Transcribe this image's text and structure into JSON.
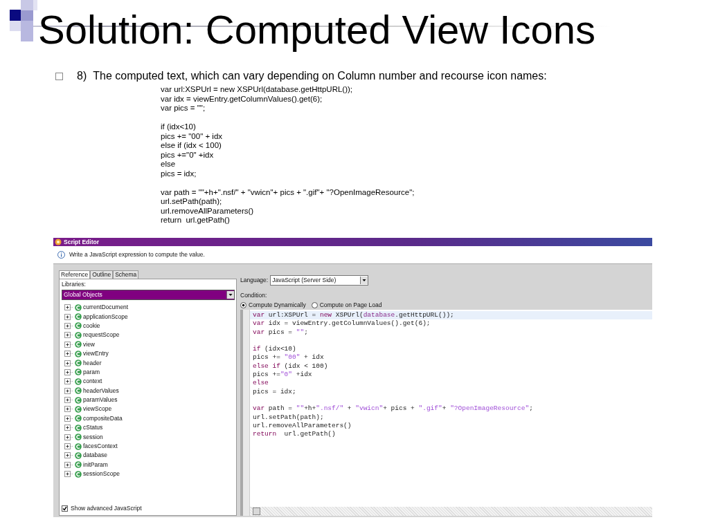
{
  "slide": {
    "title": "Solution: Computed View Icons",
    "bullet": {
      "number": "8)",
      "text": "The computed text, which can vary depending on Column number and recourse icon names:"
    },
    "code_blocks": [
      [
        "var url:XSPUrl = new XSPUrl(database.getHttpURL());",
        "var idx = viewEntry.getColumnValues().get(6);",
        "var pics = \"\";"
      ],
      [
        "if (idx<10)",
        "pics += \"00\" + idx",
        "else if (idx < 100)",
        "pics +=\"0\" +idx",
        "else",
        "pics = idx;"
      ],
      [
        "var path = \"\"+h+\".nsf/\" + \"vwicn\"+ pics + \".gif\"+ \"?OpenImageResource\";",
        "url.setPath(path);",
        "url.removeAllParameters()",
        "return  url.getPath()"
      ]
    ]
  },
  "window": {
    "title": "Script Editor",
    "info": "Write a JavaScript expression to compute the value.",
    "tabs": [
      {
        "label": "Reference",
        "selected": true
      },
      {
        "label": "Outline",
        "selected": false
      },
      {
        "label": "Schema",
        "selected": false
      }
    ],
    "libraries_label": "Libraries:",
    "libraries_value": "Global Objects",
    "tree": [
      {
        "label": "currentDocument",
        "expanded": false
      },
      {
        "label": "applicationScope",
        "expanded": false
      },
      {
        "label": "cookie",
        "expanded": false
      },
      {
        "label": "requestScope",
        "expanded": false
      },
      {
        "label": "view",
        "expanded": false
      },
      {
        "label": "viewEntry",
        "expanded": false
      },
      {
        "label": "header",
        "expanded": false
      },
      {
        "label": "param",
        "expanded": false
      },
      {
        "label": "context",
        "expanded": false
      },
      {
        "label": "headerValues",
        "expanded": false
      },
      {
        "label": "paramValues",
        "expanded": false
      },
      {
        "label": "viewScope",
        "expanded": false
      },
      {
        "label": "compositeData",
        "expanded": false
      },
      {
        "label": "cStatus",
        "expanded": false
      },
      {
        "label": "session",
        "expanded": false
      },
      {
        "label": "facesContext",
        "expanded": false
      },
      {
        "label": "database",
        "expanded": false
      },
      {
        "label": "initParam",
        "expanded": false
      },
      {
        "label": "sessionScope",
        "expanded": false
      }
    ],
    "show_advanced": {
      "label": "Show advanced JavaScript",
      "checked": true
    },
    "language_label": "Language:",
    "language_value": "JavaScript (Server Side)",
    "condition_label": "Condition:",
    "radios": [
      {
        "label": "Compute Dynamically",
        "selected": true
      },
      {
        "label": "Compute on Page Load",
        "selected": false
      }
    ],
    "editor_blocks": [
      [
        {
          "current": true,
          "tokens": [
            {
              "kind": "keyword",
              "text": "var"
            },
            {
              "kind": "text",
              "text": " url:XSPUrl = "
            },
            {
              "kind": "keyword",
              "text": "new"
            },
            {
              "kind": "text",
              "text": " XSPUrl("
            },
            {
              "kind": "global",
              "text": "database"
            },
            {
              "kind": "text",
              "text": ".getHttpURL());"
            }
          ]
        },
        {
          "current": false,
          "tokens": [
            {
              "kind": "keyword",
              "text": "var"
            },
            {
              "kind": "text",
              "text": " idx = viewEntry.getColumnValues().get(6);"
            }
          ]
        },
        {
          "current": false,
          "tokens": [
            {
              "kind": "keyword",
              "text": "var"
            },
            {
              "kind": "text",
              "text": " pics = "
            },
            {
              "kind": "string",
              "text": "\"\""
            },
            {
              "kind": "text",
              "text": ";"
            }
          ]
        }
      ],
      [
        {
          "current": false,
          "tokens": [
            {
              "kind": "keyword",
              "text": "if"
            },
            {
              "kind": "text",
              "text": " (idx<10)"
            }
          ]
        },
        {
          "current": false,
          "tokens": [
            {
              "kind": "text",
              "text": "pics += "
            },
            {
              "kind": "string",
              "text": "\"00\""
            },
            {
              "kind": "text",
              "text": " + idx"
            }
          ]
        },
        {
          "current": false,
          "tokens": [
            {
              "kind": "keyword",
              "text": "else if"
            },
            {
              "kind": "text",
              "text": " (idx < 100)"
            }
          ]
        },
        {
          "current": false,
          "tokens": [
            {
              "kind": "text",
              "text": "pics +="
            },
            {
              "kind": "string",
              "text": "\"0\""
            },
            {
              "kind": "text",
              "text": " +idx"
            }
          ]
        },
        {
          "current": false,
          "tokens": [
            {
              "kind": "keyword",
              "text": "else"
            }
          ]
        },
        {
          "current": false,
          "tokens": [
            {
              "kind": "text",
              "text": "pics = idx;"
            }
          ]
        }
      ],
      [
        {
          "current": false,
          "tokens": [
            {
              "kind": "keyword",
              "text": "var"
            },
            {
              "kind": "text",
              "text": " path = "
            },
            {
              "kind": "string",
              "text": "\"\""
            },
            {
              "kind": "text",
              "text": "+h+"
            },
            {
              "kind": "string",
              "text": "\".nsf/\""
            },
            {
              "kind": "text",
              "text": " + "
            },
            {
              "kind": "string",
              "text": "\"vwicn\""
            },
            {
              "kind": "text",
              "text": "+ pics + "
            },
            {
              "kind": "string",
              "text": "\".gif\""
            },
            {
              "kind": "text",
              "text": "+ "
            },
            {
              "kind": "string",
              "text": "\"?OpenImageResource\""
            },
            {
              "kind": "text",
              "text": ";"
            }
          ]
        },
        {
          "current": false,
          "tokens": [
            {
              "kind": "text",
              "text": "url.setPath(path);"
            }
          ]
        },
        {
          "current": false,
          "tokens": [
            {
              "kind": "text",
              "text": "url.removeAllParameters()"
            }
          ]
        },
        {
          "current": false,
          "tokens": [
            {
              "kind": "keyword",
              "text": "return"
            },
            {
              "kind": "text",
              "text": "  url.getPath()"
            }
          ]
        }
      ]
    ]
  }
}
